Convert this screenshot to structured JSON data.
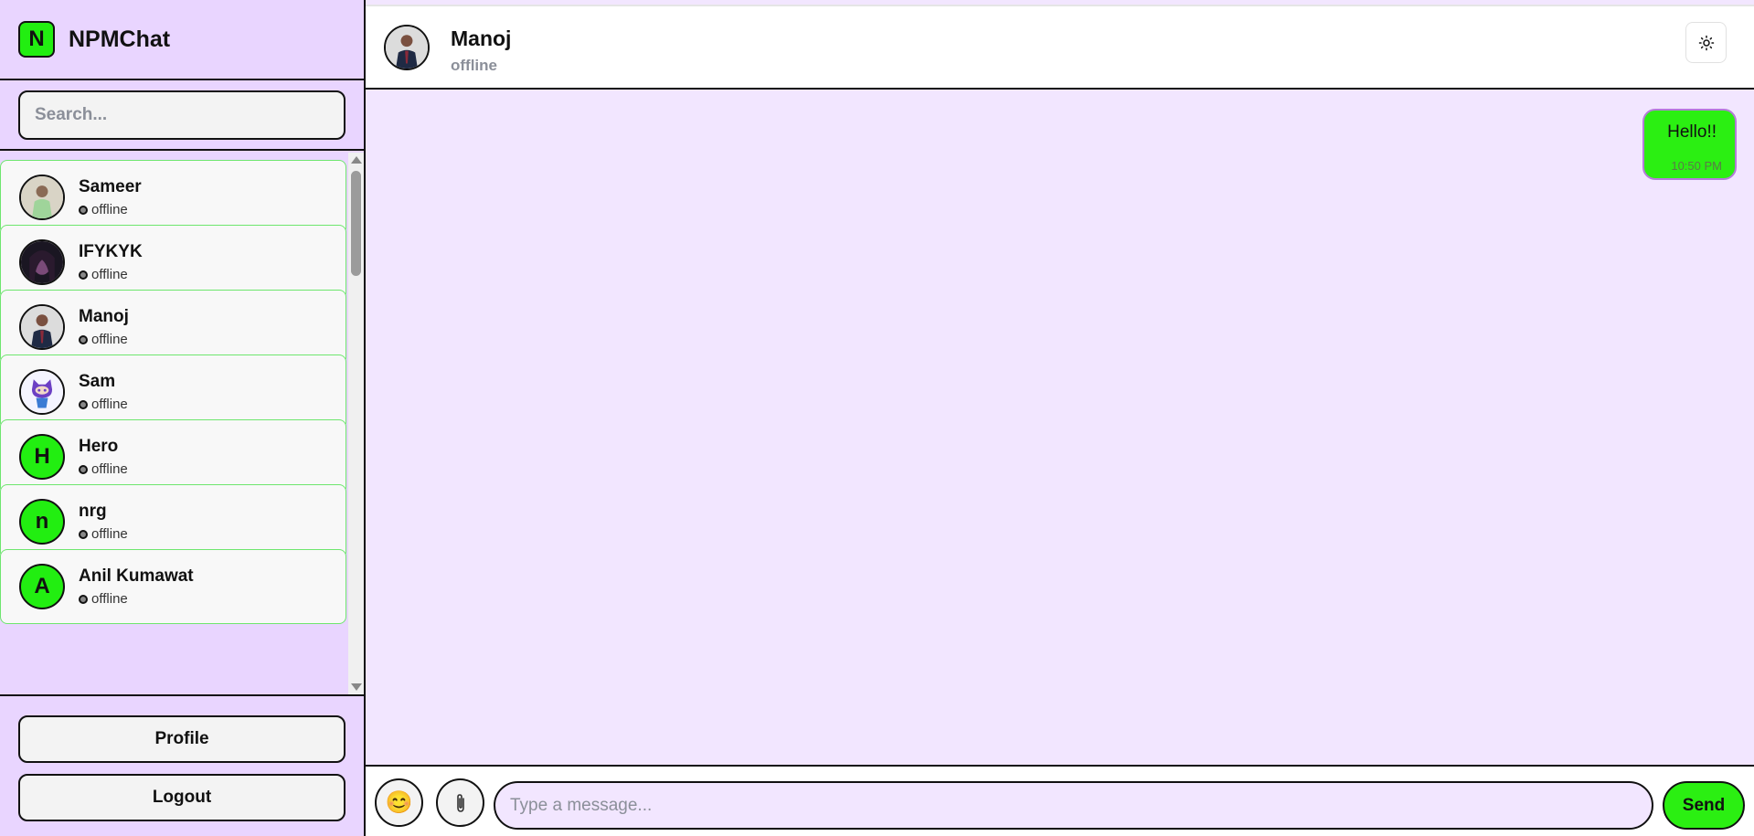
{
  "app": {
    "logo_letter": "N",
    "name": "NPMChat"
  },
  "search": {
    "placeholder": "Search..."
  },
  "contacts": [
    {
      "name": "Sameer",
      "status": "offline",
      "avatar": "photo"
    },
    {
      "name": "IFYKYK",
      "status": "offline",
      "avatar": "photo"
    },
    {
      "name": "Manoj",
      "status": "offline",
      "avatar": "photo"
    },
    {
      "name": "Sam",
      "status": "offline",
      "avatar": "octocat-icon"
    },
    {
      "name": "Hero",
      "status": "offline",
      "avatar_letter": "H"
    },
    {
      "name": "nrg",
      "status": "offline",
      "avatar_letter": "n"
    },
    {
      "name": "Anil Kumawat",
      "status": "offline",
      "avatar_letter": "A"
    }
  ],
  "sidebar_footer": {
    "profile_label": "Profile",
    "logout_label": "Logout"
  },
  "chat": {
    "name": "Manoj",
    "status": "offline",
    "theme_icon": "sun-icon",
    "messages": [
      {
        "text": "Hello!!",
        "time": "10:50 PM",
        "direction": "sent"
      }
    ]
  },
  "composer": {
    "emoji_icon": "😊",
    "attach_icon": "paperclip-icon",
    "placeholder": "Type a message...",
    "send_label": "Send"
  },
  "colors": {
    "accent_green": "#22ee11",
    "sidebar_bg": "#e9d5ff",
    "chat_bg": "#f2e6ff"
  }
}
